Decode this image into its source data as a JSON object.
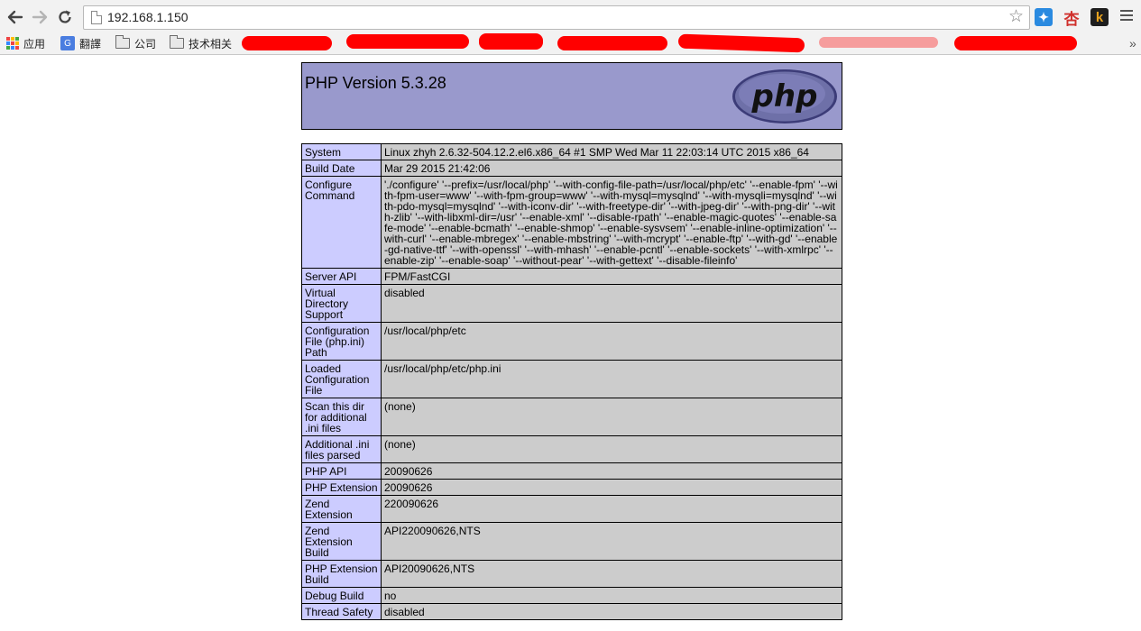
{
  "browser": {
    "url": "192.168.1.150",
    "extensions": [
      {
        "name": "bird-extension-icon",
        "glyph": "✦",
        "color": "#2a8ae0"
      },
      {
        "name": "apricot-extension-icon",
        "glyph": "杏",
        "color": "#d0312d"
      },
      {
        "name": "k-extension-icon",
        "glyph": "k",
        "color": "#e8a21f"
      }
    ]
  },
  "bookmarks": {
    "apps": "应用",
    "translate": "翻譯",
    "company": "公司",
    "tech": "技术相关",
    "more": "»"
  },
  "phpinfo": {
    "title": "PHP Version 5.3.28",
    "logo_text": "php",
    "rows": [
      {
        "key": "System",
        "value": "Linux zhyh 2.6.32-504.12.2.el6.x86_64 #1 SMP Wed Mar 11 22:03:14 UTC 2015 x86_64"
      },
      {
        "key": "Build Date",
        "value": "Mar 29 2015 21:42:06"
      },
      {
        "key": "Configure Command",
        "value": "'./configure' '--prefix=/usr/local/php' '--with-config-file-path=/usr/local/php/etc' '--enable-fpm' '--with-fpm-user=www' '--with-fpm-group=www' '--with-mysql=mysqlnd' '--with-mysqli=mysqlnd' '--with-pdo-mysql=mysqlnd' '--with-iconv-dir' '--with-freetype-dir' '--with-jpeg-dir' '--with-png-dir' '--with-zlib' '--with-libxml-dir=/usr' '--enable-xml' '--disable-rpath' '--enable-magic-quotes' '--enable-safe-mode' '--enable-bcmath' '--enable-shmop' '--enable-sysvsem' '--enable-inline-optimization' '--with-curl' '--enable-mbregex' '--enable-mbstring' '--with-mcrypt' '--enable-ftp' '--with-gd' '--enable-gd-native-ttf' '--with-openssl' '--with-mhash' '--enable-pcntl' '--enable-sockets' '--with-xmlrpc' '--enable-zip' '--enable-soap' '--without-pear' '--with-gettext' '--disable-fileinfo'"
      },
      {
        "key": "Server API",
        "value": "FPM/FastCGI"
      },
      {
        "key": "Virtual Directory Support",
        "value": "disabled"
      },
      {
        "key": "Configuration File (php.ini) Path",
        "value": "/usr/local/php/etc"
      },
      {
        "key": "Loaded Configuration File",
        "value": "/usr/local/php/etc/php.ini"
      },
      {
        "key": "Scan this dir for additional .ini files",
        "value": "(none)"
      },
      {
        "key": "Additional .ini files parsed",
        "value": "(none)"
      },
      {
        "key": "PHP API",
        "value": "20090626"
      },
      {
        "key": "PHP Extension",
        "value": "20090626"
      },
      {
        "key": "Zend Extension",
        "value": "220090626"
      },
      {
        "key": "Zend Extension Build",
        "value": "API220090626,NTS"
      },
      {
        "key": "PHP Extension Build",
        "value": "API20090626,NTS"
      },
      {
        "key": "Debug Build",
        "value": "no"
      },
      {
        "key": "Thread Safety",
        "value": "disabled"
      }
    ]
  }
}
